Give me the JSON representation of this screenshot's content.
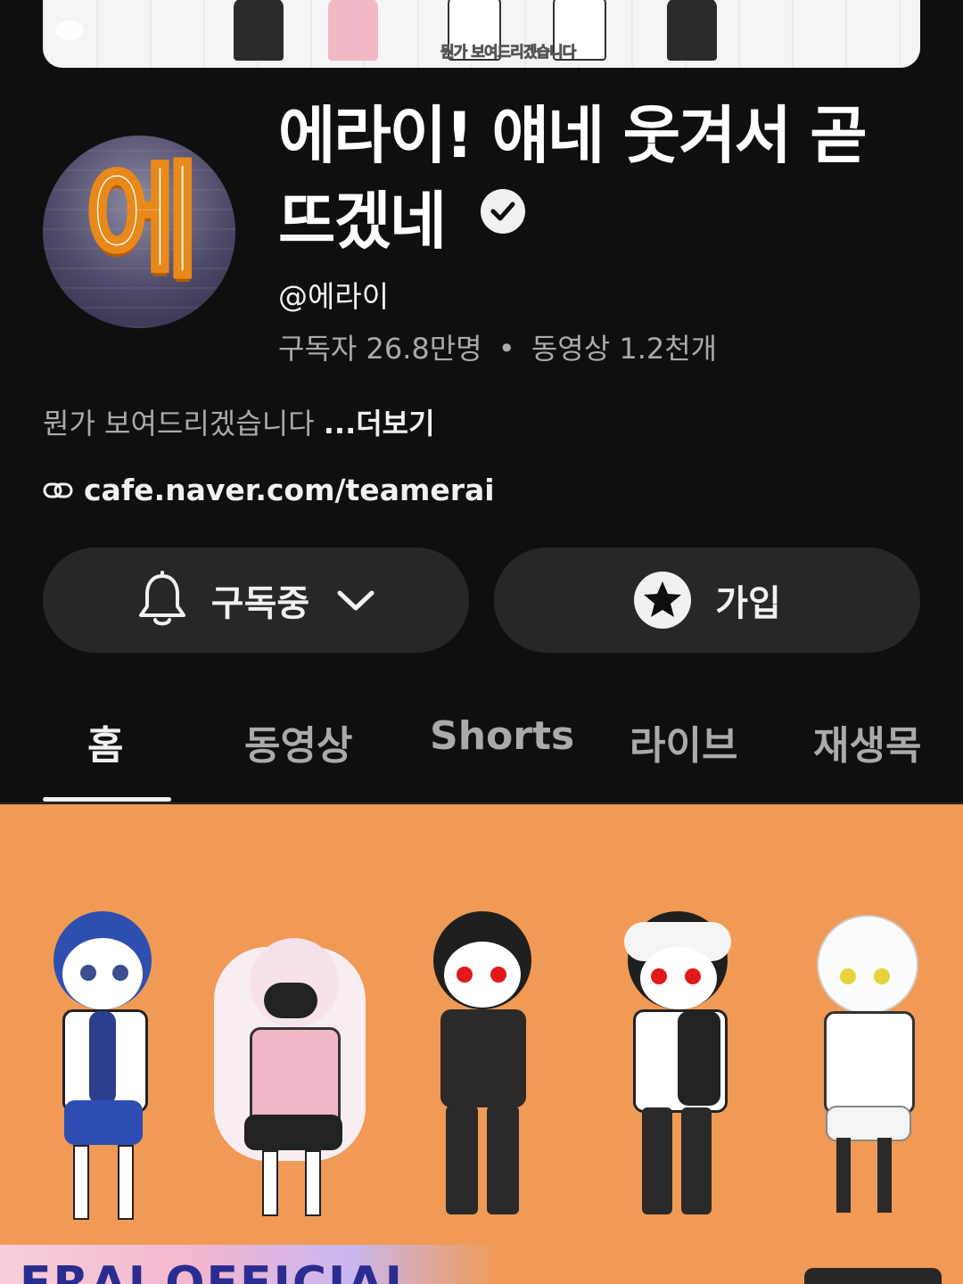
{
  "banner": {
    "caption": "뭔가 보여드리겠습니다"
  },
  "channel": {
    "name": "에라이! 얘네 웃겨서 곧 뜨겠네",
    "avatar_text": "에",
    "handle": "@에라이",
    "subscribers": "구독자 26.8만명",
    "separator": "•",
    "videos": "동영상 1.2천개",
    "description": "뭔가 보여드리겠습니다",
    "more_label": "...더보기",
    "link": "cafe.naver.com/teamerai"
  },
  "buttons": {
    "subscribed_label": "구독중",
    "join_label": "가입"
  },
  "tabs": [
    {
      "label": "홈",
      "active": true
    },
    {
      "label": "동영상",
      "active": false
    },
    {
      "label": "Shorts",
      "active": false
    },
    {
      "label": "라이브",
      "active": false
    },
    {
      "label": "재생목",
      "active": false
    }
  ],
  "featured": {
    "title_text": "ERAI OFFICIAL"
  },
  "colors": {
    "background": "#0f0f0f",
    "button_bg": "#272727",
    "secondary_text": "#aaaaaa",
    "featured_bg": "#f09a55"
  },
  "icons": [
    "verified-check-icon",
    "link-icon",
    "bell-icon",
    "chevron-down-icon",
    "star-badge-icon"
  ]
}
